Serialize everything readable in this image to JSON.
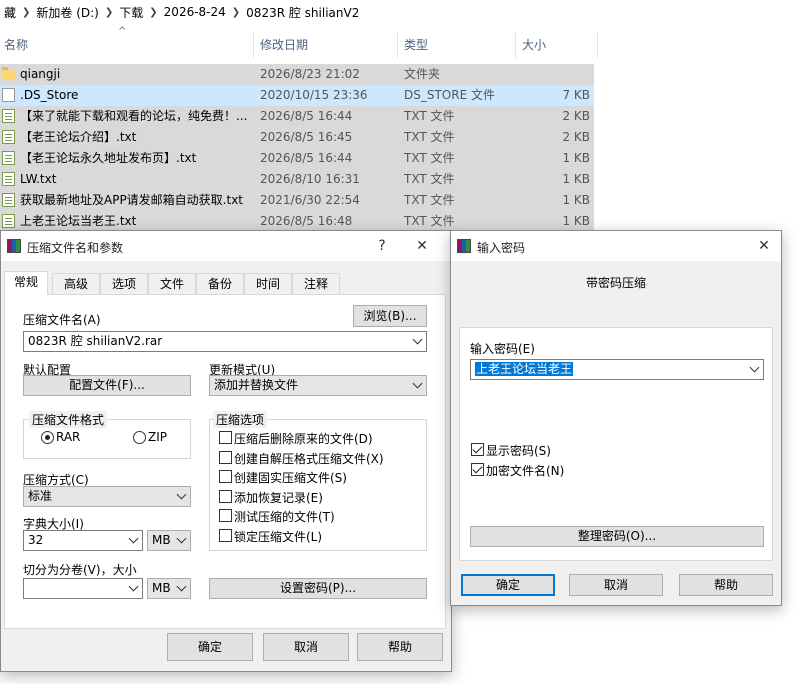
{
  "explorer": {
    "breadcrumb": [
      "藏",
      "新加卷 (D:)",
      "下载",
      "2026-8-24",
      "0823R 腔 shilianV2"
    ],
    "columns": {
      "name": "名称",
      "date": "修改日期",
      "type": "类型",
      "size": "大小"
    },
    "files": [
      {
        "name": "qiangji",
        "date": "2026/8/23 21:02",
        "type": "文件夹",
        "size": "",
        "icon": "folder-icon",
        "selected": false
      },
      {
        "name": ".DS_Store",
        "date": "2020/10/15 23:36",
        "type": "DS_STORE 文件",
        "size": "7 KB",
        "icon": "file-icon",
        "selected": true
      },
      {
        "name": "【来了就能下载和观看的论坛，纯免费！...",
        "date": "2026/8/5 16:44",
        "type": "TXT 文件",
        "size": "2 KB",
        "icon": "text-file-icon",
        "selected": false
      },
      {
        "name": "【老王论坛介绍】.txt",
        "date": "2026/8/5 16:45",
        "type": "TXT 文件",
        "size": "2 KB",
        "icon": "text-file-icon",
        "selected": false
      },
      {
        "name": "【老王论坛永久地址发布页】.txt",
        "date": "2026/8/5 16:44",
        "type": "TXT 文件",
        "size": "1 KB",
        "icon": "text-file-icon",
        "selected": false
      },
      {
        "name": "LW.txt",
        "date": "2026/8/10 16:31",
        "type": "TXT 文件",
        "size": "1 KB",
        "icon": "text-file-icon",
        "selected": false
      },
      {
        "name": "获取最新地址及APP请发邮箱自动获取.txt",
        "date": "2021/6/30 22:54",
        "type": "TXT 文件",
        "size": "1 KB",
        "icon": "text-file-icon",
        "selected": false
      },
      {
        "name": "上老王论坛当老王.txt",
        "date": "2026/8/5 16:48",
        "type": "TXT 文件",
        "size": "1 KB",
        "icon": "text-file-icon",
        "selected": false
      }
    ]
  },
  "archive_dialog": {
    "title": "压缩文件名和参数",
    "help_glyph": "?",
    "close_glyph": "✕",
    "tabs": [
      "常规",
      "高级",
      "选项",
      "文件",
      "备份",
      "时间",
      "注释"
    ],
    "archive_name_label": "压缩文件名(A)",
    "browse_button": "浏览(B)...",
    "archive_name_value": "0823R 腔 shilianV2.rar",
    "default_profile_label": "默认配置",
    "profiles_button": "配置文件(F)...",
    "update_mode_label": "更新模式(U)",
    "update_mode_value": "添加并替换文件",
    "format_group_label": "压缩文件格式",
    "format_rar": "RAR",
    "format_zip": "ZIP",
    "format_selected": "RAR",
    "options_group_label": "压缩选项",
    "options": [
      {
        "label": "压缩后删除原来的文件(D)",
        "checked": false
      },
      {
        "label": "创建自解压格式压缩文件(X)",
        "checked": false
      },
      {
        "label": "创建固实压缩文件(S)",
        "checked": false
      },
      {
        "label": "添加恢复记录(E)",
        "checked": false
      },
      {
        "label": "测试压缩的文件(T)",
        "checked": false
      },
      {
        "label": "锁定压缩文件(L)",
        "checked": false
      }
    ],
    "method_label": "压缩方式(C)",
    "method_value": "标准",
    "dict_label": "字典大小(I)",
    "dict_value": "32",
    "dict_unit": "MB",
    "split_label": "切分为分卷(V)，大小",
    "split_value": "",
    "split_unit": "MB",
    "set_password_button": "设置密码(P)...",
    "ok_button": "确定",
    "cancel_button": "取消",
    "help_button": "帮助"
  },
  "password_dialog": {
    "title": "输入密码",
    "close_glyph": "✕",
    "subtitle": "带密码压缩",
    "enter_password_label": "输入密码(E)",
    "password_value": "上老王论坛当老王",
    "show_password_label": "显示密码(S)",
    "show_password_checked": true,
    "encrypt_names_label": "加密文件名(N)",
    "encrypt_names_checked": true,
    "organize_button": "整理密码(O)...",
    "ok_button": "确定",
    "cancel_button": "取消",
    "help_button": "帮助"
  },
  "colors": {
    "selection": "#cce8ff",
    "row_bg": "#d9d9d9",
    "accent": "#0078d7",
    "dialog_bg": "#f0f0f0"
  }
}
